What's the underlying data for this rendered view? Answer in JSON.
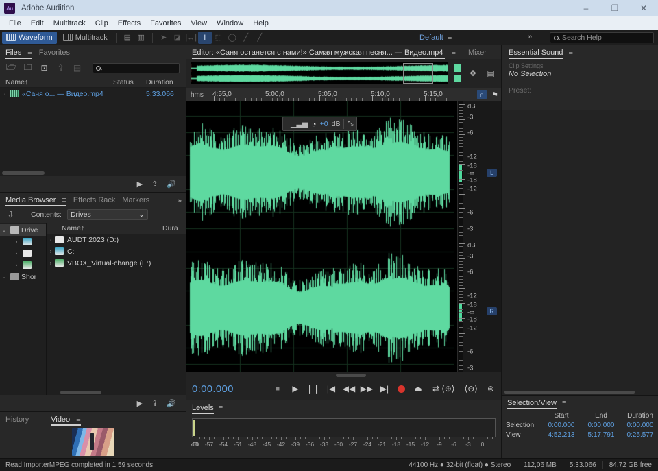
{
  "window": {
    "app_name": "Adobe Audition",
    "logo_text": "Au",
    "minimize": "–",
    "maximize": "❐",
    "close": "✕"
  },
  "menubar": {
    "items": [
      "File",
      "Edit",
      "Multitrack",
      "Clip",
      "Effects",
      "Favorites",
      "View",
      "Window",
      "Help"
    ]
  },
  "toolbar": {
    "waveform_label": "Waveform",
    "multitrack_label": "Multitrack",
    "workspace_name": "Default",
    "workspace_menu": "≡",
    "chevron": "»",
    "search_placeholder": "Search Help",
    "tools": [
      "move-tool",
      "slip-tool",
      "time-selection-tool",
      "razor-tool",
      "marquee-tool",
      "lasso-tool",
      "paintbrush-tool",
      "spot-healing-tool"
    ]
  },
  "files_panel": {
    "tabs": [
      {
        "label": "Files",
        "active": true,
        "menu": "≡"
      },
      {
        "label": "Favorites",
        "active": false
      }
    ],
    "columns": {
      "name": "Name",
      "status": "Status",
      "duration": "Duration",
      "sort": "↑"
    },
    "rows": [
      {
        "expand": "›",
        "name": "«Саня о... — Видео.mp4",
        "status": "",
        "duration": "5:33.066"
      }
    ],
    "footer_icons": [
      "play-icon",
      "insert-into-multitrack-icon",
      "auto-play-icon"
    ]
  },
  "media_browser": {
    "tabs": [
      {
        "label": "Media Browser",
        "active": true,
        "menu": "≡"
      },
      {
        "label": "Effects Rack",
        "active": false
      },
      {
        "label": "Markers",
        "active": false
      }
    ],
    "overflow": "»",
    "contents_label": "Contents:",
    "contents_value": "Drives",
    "tree": [
      {
        "label": "Drive",
        "icon": "drives-icon",
        "expanded": true,
        "selected": true
      },
      {
        "label": "",
        "icon": "disk-icon",
        "expanded": false
      },
      {
        "label": "",
        "icon": "audt-icon",
        "expanded": false
      },
      {
        "label": "",
        "icon": "vbox-icon",
        "expanded": false
      },
      {
        "label": "Shor",
        "icon": "shortcuts-icon",
        "expanded": true
      }
    ],
    "columns": {
      "name": "Name",
      "sort": "↑",
      "duration": "Dura"
    },
    "rows": [
      {
        "expand": "›",
        "icon": "audt-icon",
        "name": "AUDT 2023 (D:)"
      },
      {
        "expand": "›",
        "icon": "disk-icon",
        "name": "C:"
      },
      {
        "expand": "›",
        "icon": "vbox-icon",
        "name": "VBOX_Virtual-change (E:)"
      }
    ]
  },
  "history_video": {
    "tabs": [
      {
        "label": "History",
        "active": false
      },
      {
        "label": "Video",
        "active": true,
        "menu": "≡"
      }
    ]
  },
  "editor": {
    "title": "Editor: «Саня останется с нами!» Самая мужская песня... — Видео.mp4",
    "menu": "≡",
    "mixer_tab": "Mixer",
    "ruler_unit": "hms",
    "ruler_ticks": [
      "4:55,0",
      "5:00,0",
      "5:05,0",
      "5:10,0",
      "5:15,0"
    ],
    "gain_overlay": {
      "value": "+0",
      "unit": "dB",
      "pin": "⤡"
    },
    "db_labels": [
      "dB",
      "-3",
      "-6",
      "-12",
      "-18",
      "-∞",
      "-18",
      "-12",
      "-6",
      "-3"
    ],
    "channels": [
      {
        "id": "L",
        "badge": "L"
      },
      {
        "id": "R",
        "badge": "R"
      }
    ],
    "waveform_color": "#5ed9a0",
    "overview_icons": [
      "fit-zoom-icon",
      "show-hide-icon"
    ],
    "ruler_icons": [
      "loop-icon",
      "marker-icon"
    ]
  },
  "transport": {
    "timecode": "0:00.000",
    "buttons": [
      "stop",
      "play",
      "pause",
      "skip-to-start",
      "rewind",
      "fast-forward",
      "skip-to-end",
      "record",
      "loop-playback",
      "skip-selection"
    ],
    "zoom_buttons": [
      "zoom-in-time-icon",
      "zoom-out-time-icon",
      "zoom-out-full-icon"
    ]
  },
  "levels": {
    "title": "Levels",
    "menu": "≡",
    "db_label": "dB",
    "scale": [
      "-60",
      "-57",
      "-54",
      "-51",
      "-48",
      "-45",
      "-42",
      "-39",
      "-36",
      "-33",
      "-30",
      "-27",
      "-24",
      "-21",
      "-18",
      "-15",
      "-12",
      "-9",
      "-6",
      "-3",
      "0"
    ]
  },
  "essential_sound": {
    "title": "Essential Sound",
    "menu": "≡",
    "section_hint": "Clip Settings",
    "no_selection": "No Selection",
    "preset_label": "Preset:"
  },
  "selection_view": {
    "title": "Selection/View",
    "menu": "≡",
    "headers": [
      "Start",
      "End",
      "Duration"
    ],
    "rows": [
      {
        "label": "Selection",
        "start": "0:00.000",
        "end": "0:00.000",
        "duration": "0:00.000"
      },
      {
        "label": "View",
        "start": "4:52.213",
        "end": "5:17.791",
        "duration": "0:25.577"
      }
    ]
  },
  "statusbar": {
    "message": "Read ImporterMPEG completed in 1,59 seconds",
    "format": "44100 Hz ● 32-bit (float) ● Stereo",
    "size": "112,06 MB",
    "duration": "5:33.066",
    "free_space": "84,72 GB free"
  }
}
